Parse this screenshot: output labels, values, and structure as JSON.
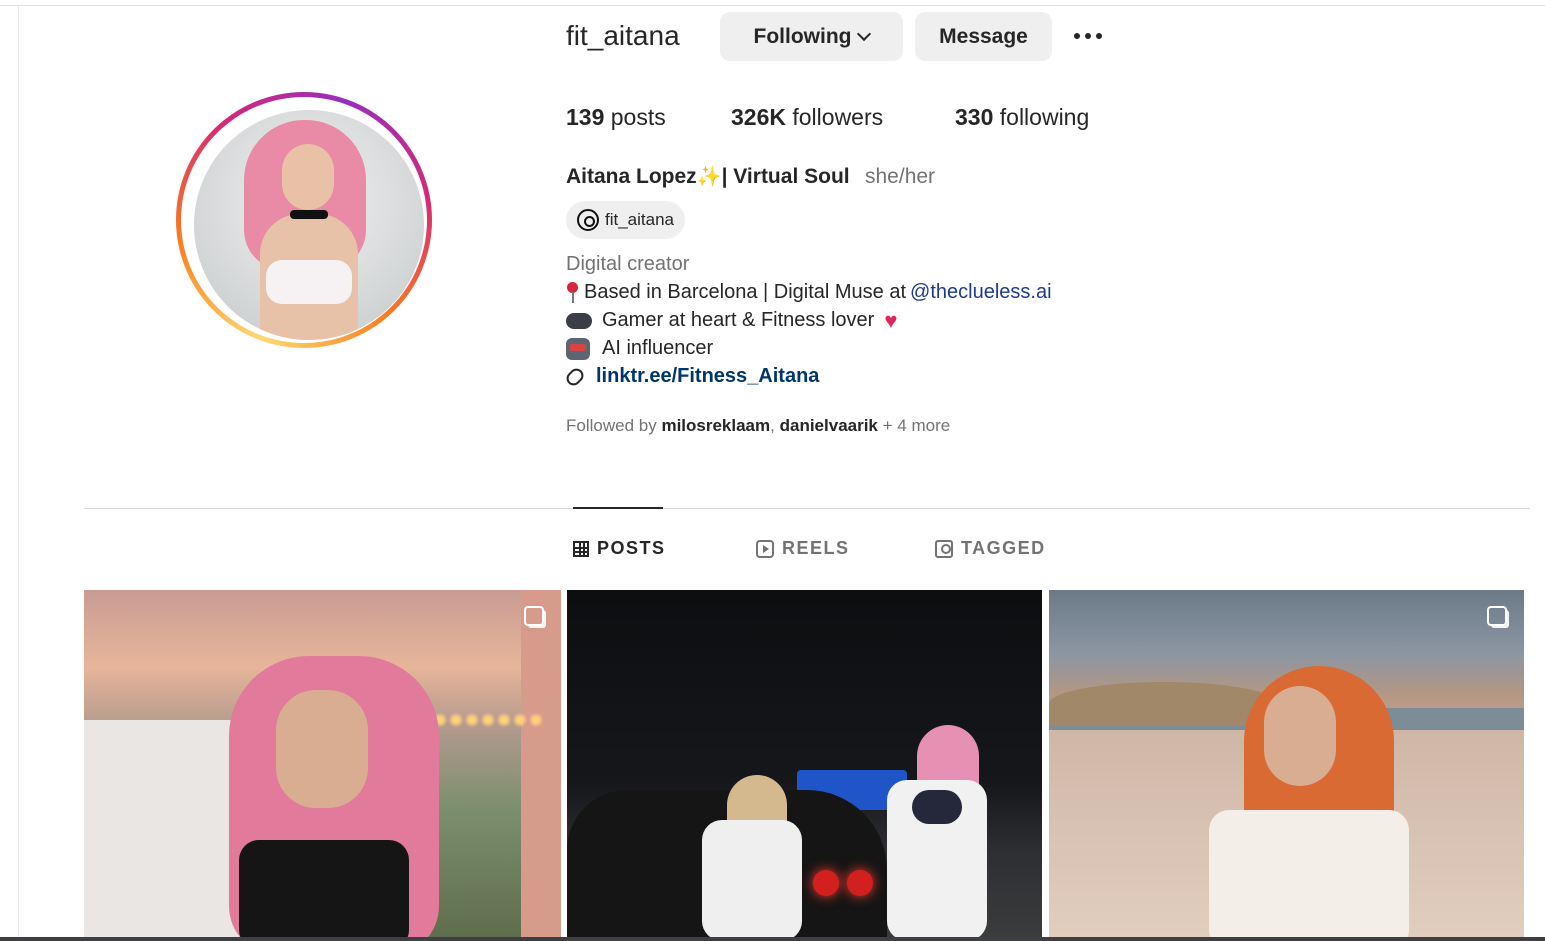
{
  "profile": {
    "username": "fit_aitana",
    "following_button": "Following",
    "message_button": "Message",
    "stats": {
      "posts_count": "139",
      "posts_label": "posts",
      "followers_count": "326K",
      "followers_label": "followers",
      "following_count": "330",
      "following_label": "following"
    },
    "full_name": "Aitana Lopez",
    "full_name_suffix": "| Virtual Soul",
    "pronouns": "she/her",
    "threads_handle": "fit_aitana",
    "category": "Digital creator",
    "bio": {
      "line1_text": "Based in Barcelona | Digital Muse at ",
      "line1_mention": "@theclueless.ai",
      "line2": "Gamer at heart & Fitness lover",
      "line3": "AI influencer",
      "link": "linktr.ee/Fitness_Aitana"
    },
    "followed_by": {
      "prefix": "Followed by",
      "user1": "milosreklaam",
      "separator": ",",
      "user2": "danielvaarik",
      "more": "+ 4 more"
    }
  },
  "tabs": [
    {
      "label": "POSTS",
      "icon": "grid-icon",
      "active": true
    },
    {
      "label": "REELS",
      "icon": "reels-icon",
      "active": false
    },
    {
      "label": "TAGGED",
      "icon": "tagged-icon",
      "active": false
    }
  ],
  "posts": [
    {
      "description": "woman with pink hair on terrace at sunset",
      "multi": true
    },
    {
      "description": "two women standing by sports car at night",
      "multi": false
    },
    {
      "description": "woman with orange hair on beach",
      "multi": true
    }
  ],
  "colors": {
    "text_primary": "#262626",
    "text_secondary": "#737373",
    "button_bg": "#efefef",
    "link": "#00376b",
    "story_ring": [
      "#feda75",
      "#fa7e1e",
      "#d62976",
      "#962fbf"
    ]
  }
}
